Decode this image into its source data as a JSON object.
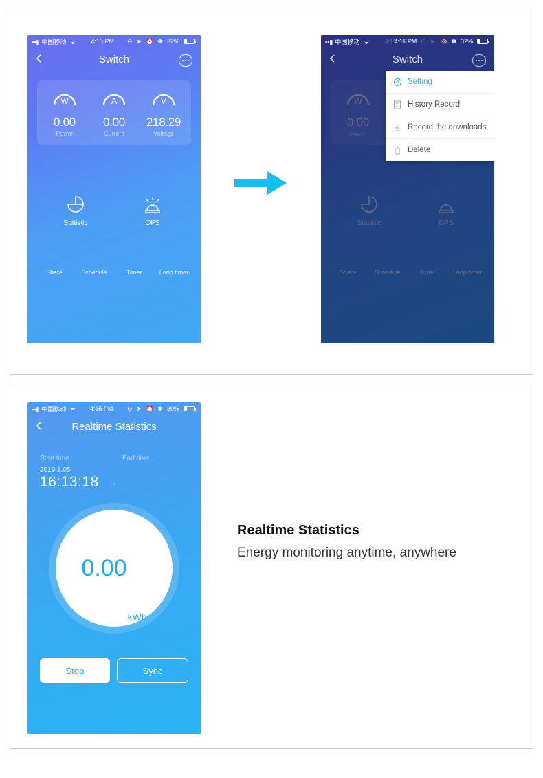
{
  "screen1": {
    "statusbar": {
      "carrier": "中国移动",
      "time": "4:13 PM",
      "battery": "32%"
    },
    "title": "Switch",
    "metrics": [
      {
        "letter": "W",
        "value": "0.00",
        "label": "Power"
      },
      {
        "letter": "A",
        "value": "0.00",
        "label": "Current"
      },
      {
        "letter": "V",
        "value": "218.29",
        "label": "Voltage"
      }
    ],
    "row2": [
      {
        "label": "Statistic"
      },
      {
        "label": "OPS"
      }
    ],
    "row4": [
      {
        "label": "Share"
      },
      {
        "label": "Schedule"
      },
      {
        "label": "Timer"
      },
      {
        "label": "Loop timer"
      }
    ]
  },
  "screen2": {
    "statusbar": {
      "carrier": "中国移动",
      "time": "4:11 PM",
      "battery": "32%"
    },
    "title": "Switch",
    "menu": [
      {
        "label": "Setting",
        "active": true
      },
      {
        "label": "History Record"
      },
      {
        "label": "Record the downloads"
      },
      {
        "label": "Delete"
      }
    ]
  },
  "screen3": {
    "statusbar": {
      "carrier": "中国移动",
      "time": "4:15 PM",
      "battery": "30%"
    },
    "title": "Realtime Statistics",
    "start_label": "Start time",
    "end_label": "End time",
    "date": "2019.1.05",
    "clock": "16:13:18",
    "energy_value": "0.00",
    "energy_unit": "kWh",
    "stop": "Stop",
    "sync": "Sync"
  },
  "caption": {
    "heading": "Realtime Statistics",
    "sub": "Energy monitoring anytime, anywhere"
  }
}
